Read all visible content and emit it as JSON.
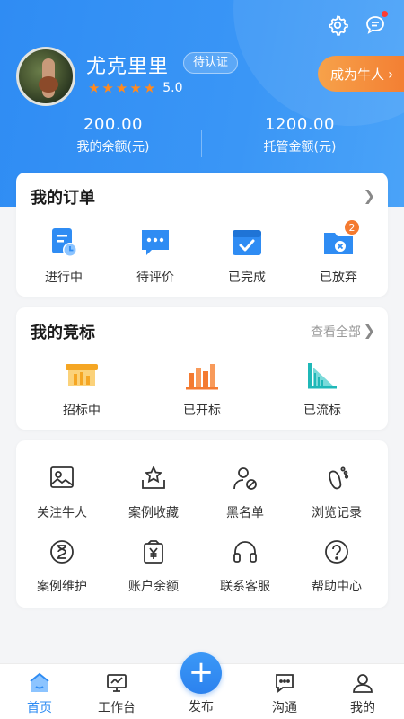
{
  "profile": {
    "name": "尤克里里",
    "cert_status": "待认证",
    "stars": 5,
    "rating": "5.0",
    "become_label": "成为牛人",
    "balance": {
      "value": "200.00",
      "label": "我的余额(元)"
    },
    "escrow": {
      "value": "1200.00",
      "label": "托管金额(元)"
    }
  },
  "orders": {
    "title": "我的订单",
    "items": [
      {
        "label": "进行中",
        "icon": "clock-doc-icon"
      },
      {
        "label": "待评价",
        "icon": "chat-dots-icon"
      },
      {
        "label": "已完成",
        "icon": "check-box-icon"
      },
      {
        "label": "已放弃",
        "icon": "folder-x-icon",
        "badge": "2"
      }
    ]
  },
  "bids": {
    "title": "我的竞标",
    "view_all": "查看全部",
    "items": [
      {
        "label": "招标中",
        "icon": "bid-board-icon"
      },
      {
        "label": "已开标",
        "icon": "bar-chart-icon"
      },
      {
        "label": "已流标",
        "icon": "triangle-chart-icon"
      }
    ]
  },
  "tools": {
    "items": [
      {
        "label": "关注牛人",
        "icon": "follow-image-icon"
      },
      {
        "label": "案例收藏",
        "icon": "star-tray-icon"
      },
      {
        "label": "黑名单",
        "icon": "user-block-icon"
      },
      {
        "label": "浏览记录",
        "icon": "footprint-icon"
      },
      {
        "label": "案例维护",
        "icon": "hourglass-icon"
      },
      {
        "label": "账户余额",
        "icon": "wallet-yen-icon"
      },
      {
        "label": "联系客服",
        "icon": "headset-icon"
      },
      {
        "label": "帮助中心",
        "icon": "question-icon"
      }
    ]
  },
  "tabbar": {
    "items": [
      {
        "label": "首页",
        "icon": "home-icon",
        "active": true
      },
      {
        "label": "工作台",
        "icon": "monitor-icon"
      },
      {
        "label": "发布",
        "icon": "plus-icon"
      },
      {
        "label": "沟通",
        "icon": "chat-icon"
      },
      {
        "label": "我的",
        "icon": "person-icon"
      }
    ]
  },
  "colors": {
    "primary": "#2f8cf3",
    "orange": "#f37f33",
    "teal": "#1fb8b8"
  }
}
